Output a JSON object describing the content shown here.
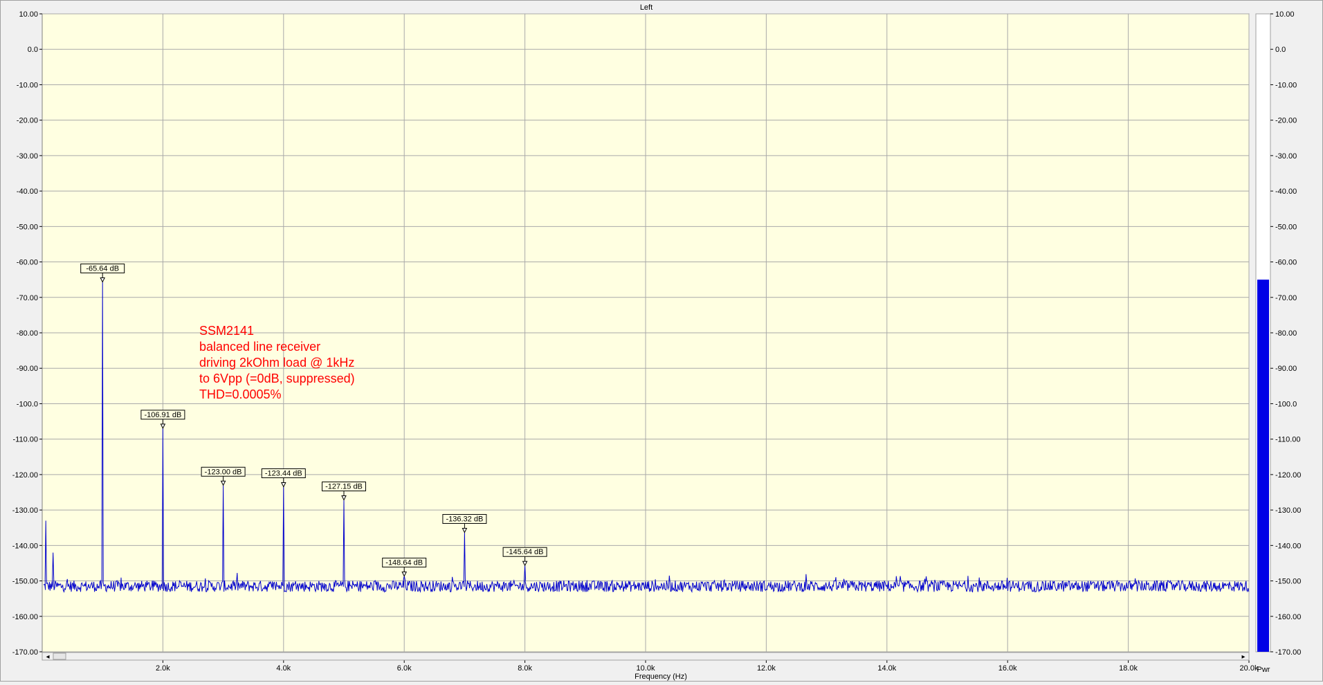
{
  "chart_data": {
    "type": "line",
    "title": "Left",
    "xlabel": "Frequency (Hz)",
    "ylabel": "",
    "xlim": [
      0,
      20000
    ],
    "ylim": [
      -172,
      10
    ],
    "x_ticks": [
      2000,
      4000,
      6000,
      8000,
      10000,
      12000,
      14000,
      16000,
      18000,
      20000
    ],
    "x_tick_labels": [
      "2.0k",
      "4.0k",
      "6.0k",
      "8.0k",
      "10.0k",
      "12.0k",
      "14.0k",
      "16.0k",
      "18.0k",
      "20.0k"
    ],
    "y_ticks": [
      10,
      0,
      -10,
      -20,
      -30,
      -40,
      -50,
      -60,
      -70,
      -80,
      -90,
      -100,
      -110,
      -120,
      -130,
      -140,
      -150,
      -160,
      -170
    ],
    "y_tick_labels": [
      "10.00",
      "0.0",
      "-10.00",
      "-20.00",
      "-30.00",
      "-40.00",
      "-50.00",
      "-60.00",
      "-70.00",
      "-80.00",
      "-90.00",
      "-100.0",
      "-110.00",
      "-120.00",
      "-130.00",
      "-140.00",
      "-150.00",
      "-160.00",
      "-170.00"
    ],
    "grid": true,
    "noise_floor_db": -151.5,
    "series": [
      {
        "color": "#0000cc",
        "peaks": [
          {
            "x": 60,
            "y": -133
          },
          {
            "x": 180,
            "y": -142
          },
          {
            "x": 1000,
            "y": -65.64
          },
          {
            "x": 2000,
            "y": -106.91
          },
          {
            "x": 3000,
            "y": -123.0
          },
          {
            "x": 4000,
            "y": -123.44
          },
          {
            "x": 5000,
            "y": -127.15
          },
          {
            "x": 6000,
            "y": -148.64
          },
          {
            "x": 7000,
            "y": -136.32
          },
          {
            "x": 8000,
            "y": -145.64
          }
        ]
      }
    ],
    "markers": [
      {
        "x": 1000,
        "y": -65.64,
        "label": "-65.64 dB"
      },
      {
        "x": 2000,
        "y": -106.91,
        "label": "-106.91 dB"
      },
      {
        "x": 3000,
        "y": -123.0,
        "label": "-123.00 dB"
      },
      {
        "x": 4000,
        "y": -123.44,
        "label": "-123.44 dB"
      },
      {
        "x": 5000,
        "y": -127.15,
        "label": "-127.15 dB"
      },
      {
        "x": 6000,
        "y": -148.64,
        "label": "-148.64 dB"
      },
      {
        "x": 7000,
        "y": -136.32,
        "label": "-136.32 dB"
      },
      {
        "x": 8000,
        "y": -145.64,
        "label": "-145.64 dB"
      }
    ],
    "annotation": {
      "lines": [
        "SSM2141",
        "balanced line receiver",
        "driving 2kOhm load @ 1kHz",
        "to 6Vpp (=0dB, suppressed)",
        "THD=0.0005%"
      ],
      "color": "#ff0000"
    },
    "plot_background": "#ffffe1",
    "power_meter": {
      "label": "Pwr",
      "value_db": -65,
      "color": "#0000e6",
      "y_tick_labels": [
        "10.00",
        "0.0",
        "-10.00",
        "-20.00",
        "-30.00",
        "-40.00",
        "-50.00",
        "-60.00",
        "-70.00",
        "-80.00",
        "-90.00",
        "-100.0",
        "-110.00",
        "-120.00",
        "-130.00",
        "-140.00",
        "-150.00",
        "-160.00",
        "-170.00"
      ]
    }
  },
  "scrollbar": {
    "left_arrow": "◂",
    "right_arrow": "▸"
  }
}
